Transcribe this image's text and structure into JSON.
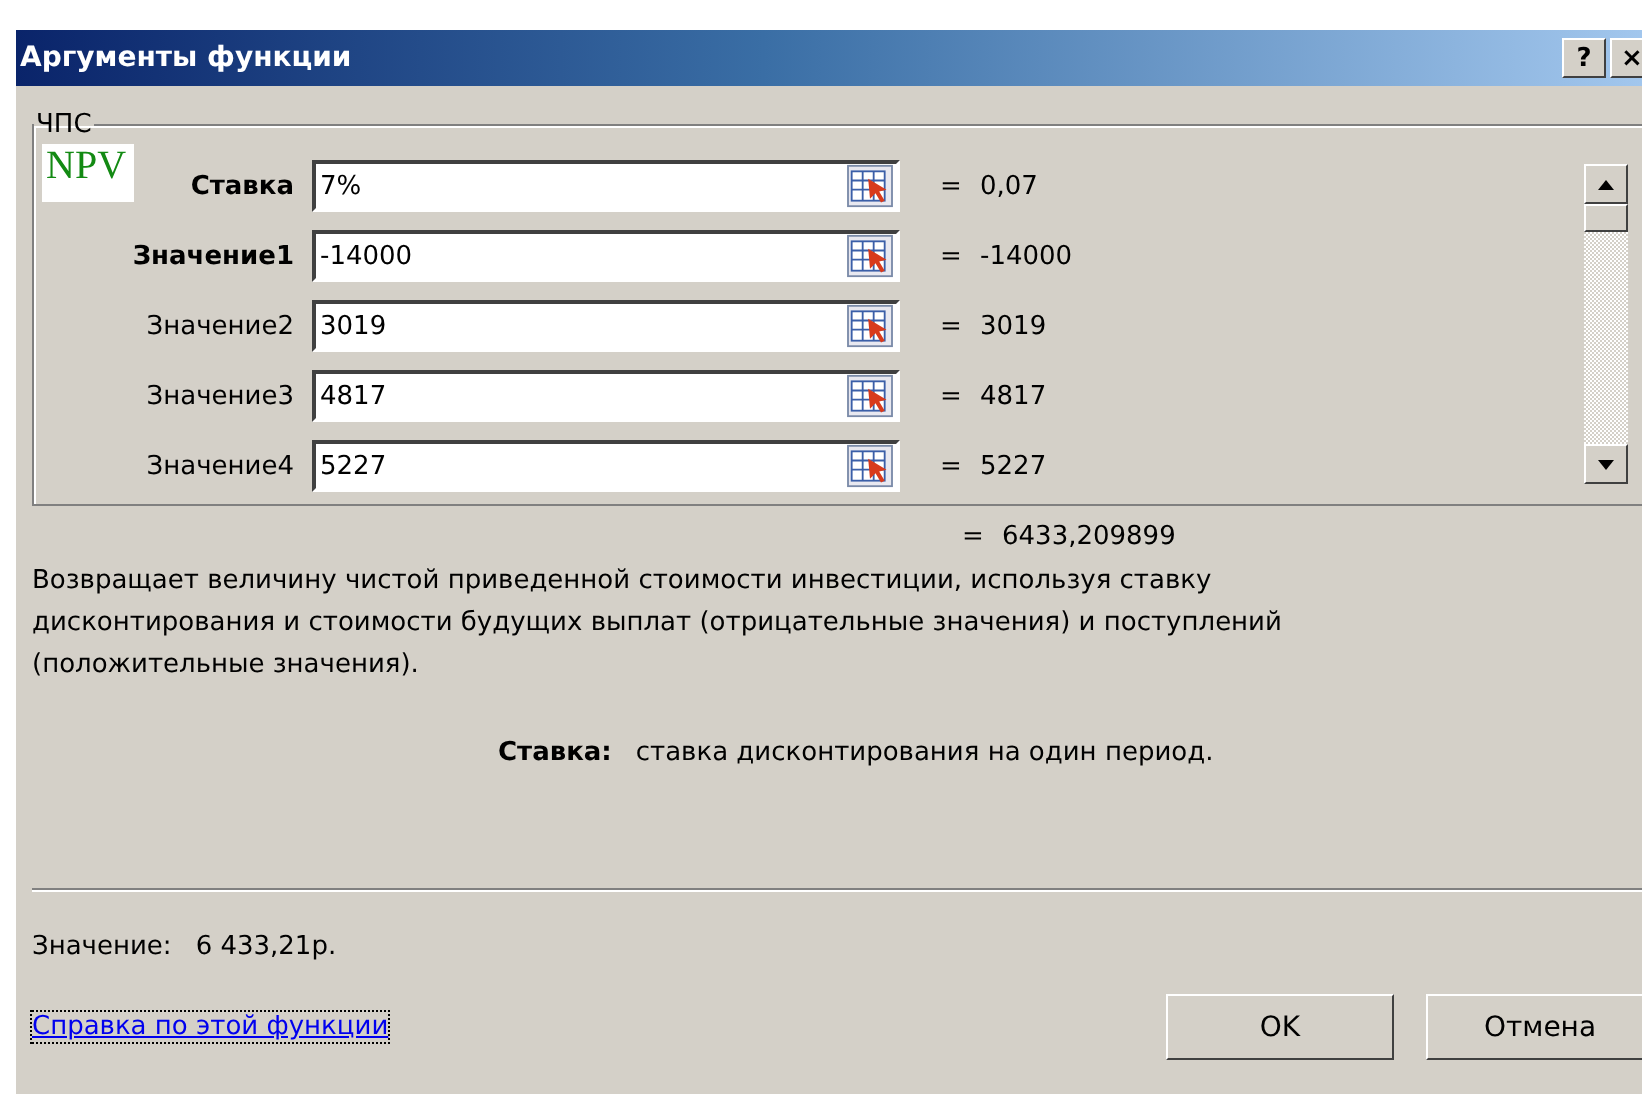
{
  "window": {
    "title": "Аргументы функции",
    "buttons": [
      "?",
      "×"
    ]
  },
  "group": {
    "title": "ЧПС",
    "logo": "NPV"
  },
  "arguments": [
    {
      "label": "Ставка",
      "required": true,
      "value": "7%",
      "result": "0,07"
    },
    {
      "label": "Значение1",
      "required": true,
      "value": "-14000",
      "result": "-14000"
    },
    {
      "label": "Значение2",
      "required": false,
      "value": "3019",
      "result": "3019"
    },
    {
      "label": "Значение3",
      "required": false,
      "value": "4817",
      "result": "4817"
    },
    {
      "label": "Значение4",
      "required": false,
      "value": "5227",
      "result": "5227"
    }
  ],
  "equals": "=",
  "total": "6433,209899",
  "description": "Возвращает величину чистой приведенной стоимости инвестиции, используя ставку дисконтирования и стоимости будущих выплат (отрицательные значения) и поступлений (положительные значения).",
  "arg_help": {
    "name": "Ставка:",
    "text": "ставка дисконтирования на один период."
  },
  "value_line": {
    "label": "Значение:",
    "value": "6 433,21р."
  },
  "help_link": "Справка по этой функции",
  "buttons": [
    "OK",
    "Отмена"
  ]
}
